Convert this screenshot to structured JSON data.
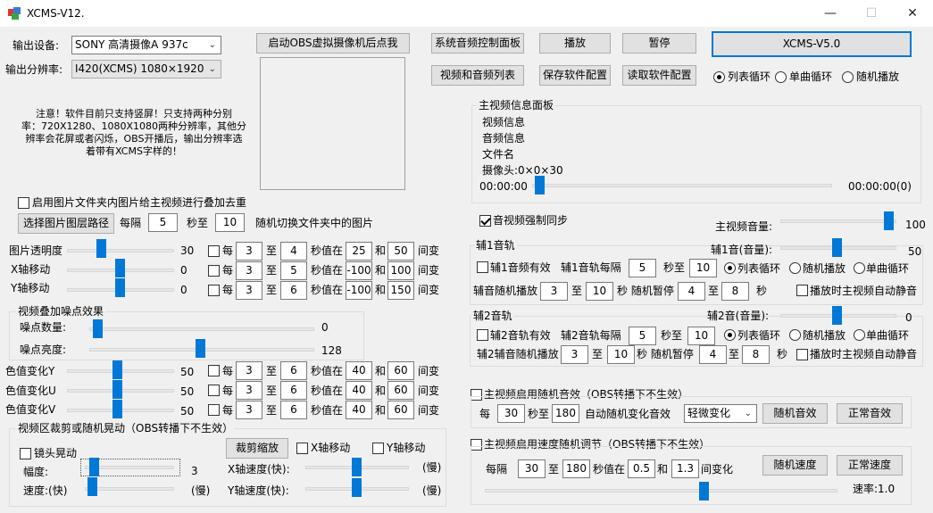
{
  "window": {
    "title": "XCMS-V12.",
    "minimize": "—",
    "maximize": "☐",
    "close": "✕"
  },
  "left": {
    "output_device_label": "输出设备:",
    "output_device_value": "SONY 高清摄像A 937c",
    "output_res_label": "输出分辨率:",
    "output_res_value": "I420(XCMS) 1080×1920",
    "notice": "注意！软件目前只支持竖屏！只支持两种分别\n率：720X1280、1080X1080两种分辨率，其他分\n辨率会花屏或者闪烁，OBS开播后，输出分辨率选\n着带有XCMS字样的！",
    "overlay_checkbox": "启用图片文件夹内图片给主视频进行叠加去重",
    "select_path_button": "选择图片图层路径",
    "every": "每隔",
    "interval_a": "5",
    "sec_to": "秒至",
    "interval_b": "10",
    "random_switch": "随机切换文件夹中的图片"
  },
  "obs_button": "启动OBS虚拟摄像机后点我",
  "rows": {
    "mei": "每",
    "zhi": "至",
    "sec_val": "秒值在",
    "he": "和",
    "jianbian": "间变",
    "opacity": {
      "label": "图片透明度",
      "value": "30",
      "a": "3",
      "b": "4",
      "c": "25",
      "d": "50"
    },
    "xmove": {
      "label": "X轴移动",
      "value": "0",
      "a": "3",
      "b": "5",
      "c": "-100",
      "d": "100"
    },
    "ymove": {
      "label": "Y轴移动",
      "value": "0",
      "a": "3",
      "b": "6",
      "c": "-100",
      "d": "150"
    }
  },
  "noise": {
    "group": "视频叠加噪点效果",
    "count_label": "噪点数量:",
    "count_value": "0",
    "bright_label": "噪点亮度:",
    "bright_value": "128"
  },
  "color": {
    "y": {
      "label": "色值变化Y",
      "value": "50",
      "a": "3",
      "b": "6",
      "c": "40",
      "d": "60"
    },
    "u": {
      "label": "色值变化U",
      "value": "50",
      "a": "3",
      "b": "6",
      "c": "40",
      "d": "60"
    },
    "v": {
      "label": "色值变化V",
      "value": "50",
      "a": "3",
      "b": "6",
      "c": "40",
      "d": "60"
    }
  },
  "crop": {
    "group": "视频区裁剪或随机晃动（OBS转播下不生效）",
    "shake_checkbox": "镜头晃动",
    "crop_button": "裁剪缩放",
    "xmove_checkbox": "X轴移动",
    "ymove_checkbox": "Y轴移动",
    "amplitude_label": "幅度:",
    "amplitude_value": "3",
    "speed_label": "速度:(快)",
    "slow": "(慢)",
    "xspeed_label": "X轴速度(快):",
    "yspeed_label": "Y轴速度(快):"
  },
  "top_buttons": {
    "sys_audio": "系统音频控制面板",
    "play": "播放",
    "pause": "暂停",
    "version": "XCMS-V5.0",
    "video_audio_list": "视频和音频列表",
    "save_config": "保存软件配置",
    "load_config": "读取软件配置"
  },
  "loop": {
    "list": "列表循环",
    "single": "单曲循环",
    "random": "随机播放"
  },
  "info": {
    "group": "主视频信息面板",
    "video_info": "视频信息",
    "audio_info": "音频信息",
    "filename": "文件名",
    "camera": "摄像头:0×0×30",
    "time_start": "00:00:00",
    "time_end": "00:00:00(0)"
  },
  "sync": {
    "checkbox": "音视频强制同步",
    "vol_label": "主视频音量:",
    "vol_value": "100"
  },
  "aux1": {
    "group": "辅1音轨",
    "vol_label": "辅1音(音量):",
    "vol_value": "50",
    "enable": "辅1音频有效",
    "every_label": "辅1音轨每隔",
    "a": "5",
    "sec_to": "秒至",
    "b": "10",
    "sec": "秒",
    "list": "列表循环",
    "random": "随机播放",
    "single": "单曲循环",
    "rand_label": "辅音随机播放",
    "c": "3",
    "zhi": "至",
    "d": "10",
    "pause_label": "秒 随机暂停",
    "e": "4",
    "f": "8",
    "sec2": "秒",
    "auto_mute": "播放时主视频自动静音"
  },
  "aux2": {
    "group": "辅2音轨",
    "vol_label": "辅2音(音量):",
    "vol_value": "0",
    "enable": "辅2音轨有效",
    "every_label": "辅2音轨每隔",
    "a": "5",
    "sec_to": "秒至",
    "b": "10",
    "sec": "秒",
    "list": "列表循环",
    "random": "随机播放",
    "single": "单曲循环",
    "rand_label": "辅2辅音随机播放",
    "c": "3",
    "zhi": "至",
    "d": "10",
    "pause_label": "秒  随机暂停",
    "e": "4",
    "f": "8",
    "sec2": "秒",
    "auto_mute": "播放时主视频自动静音"
  },
  "effect": {
    "checkbox": "主视频启用随机音效（OBS转播下不生效）",
    "every": "每",
    "a": "30",
    "sec_to": "秒至",
    "b": "180",
    "auto_label": "自动随机变化音效",
    "select": "轻微变化",
    "random_btn": "随机音效",
    "normal_btn": "正常音效"
  },
  "speed": {
    "checkbox": "主视频启用速度随机调节（OBS转播下不生效）",
    "every": "每隔",
    "a": "30",
    "zhi": "至",
    "b": "180",
    "sec_val": "秒值在",
    "c": "0.5",
    "he": "和",
    "d": "1.3",
    "change": "间变化",
    "random_btn": "随机速度",
    "normal_btn": "正常速度",
    "rate": "速率:1.0"
  }
}
